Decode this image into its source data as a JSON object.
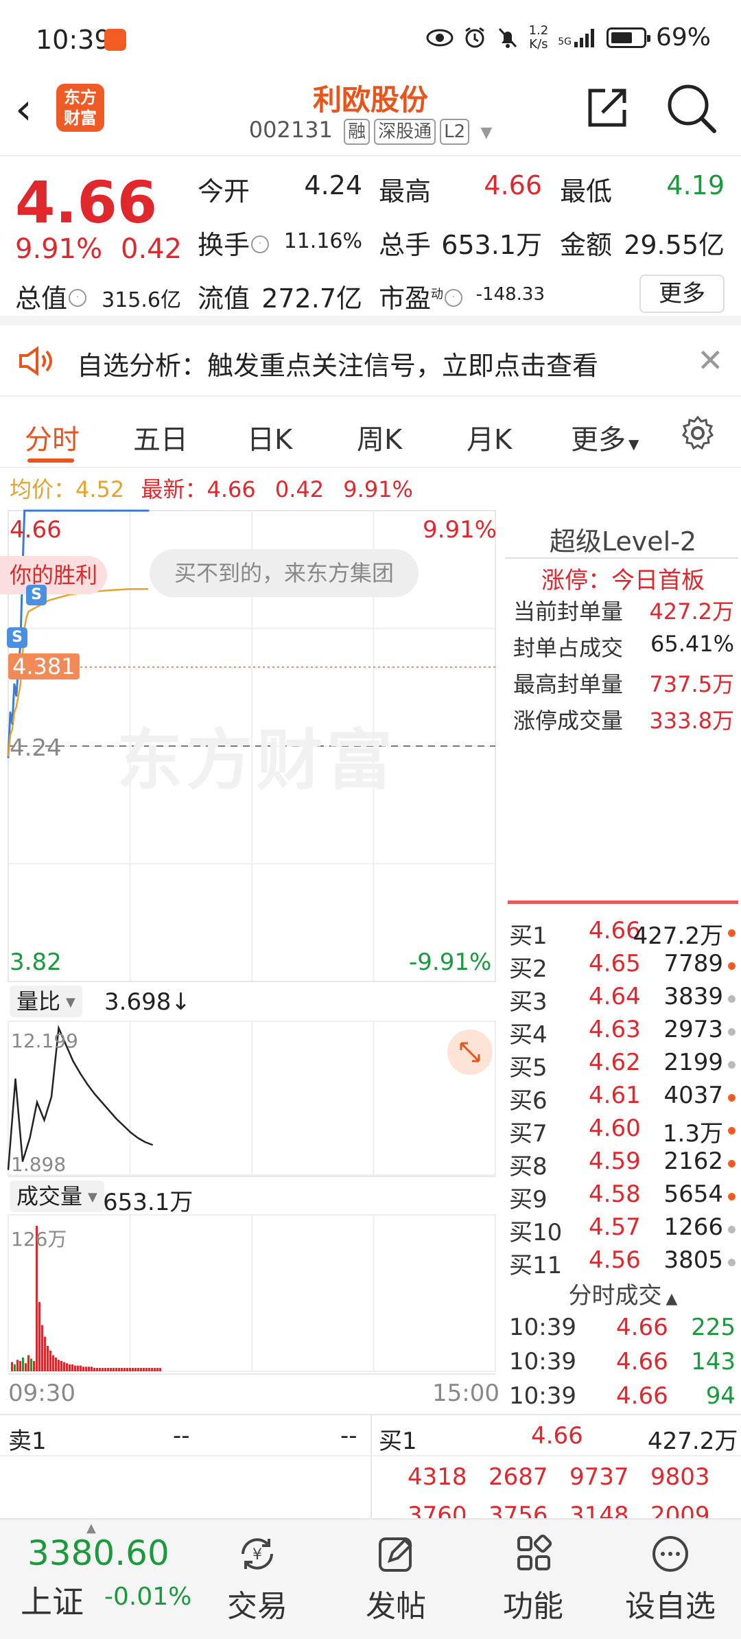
{
  "status_bar": {
    "time": "10:39",
    "net_speed_top": "1.2",
    "net_speed_unit": "K/s",
    "signal": "5G",
    "battery": "69%",
    "battery_level": 0.69
  },
  "header": {
    "logo_text": "东方财富",
    "stock_name": "利欧股份",
    "code": "002131",
    "tags": [
      "融",
      "深股通",
      "L2"
    ]
  },
  "quote": {
    "price": "4.66",
    "pct": "9.91%",
    "chg": "0.42",
    "open_label": "今开",
    "open": "4.24",
    "high_label": "最高",
    "high": "4.66",
    "low_label": "最低",
    "low": "4.19",
    "turnover_label": "换手",
    "turnover": "11.16%",
    "volume_label": "总手",
    "volume": "653.1万",
    "amount_label": "金额",
    "amount": "29.55亿",
    "mktcap_label": "总值",
    "mktcap": "315.6亿",
    "float_label": "流值",
    "float": "272.7亿",
    "pe_label": "市盈",
    "pe_sup": "动",
    "pe": "-148.33",
    "more": "更多"
  },
  "alert": {
    "text": "自选分析：触发重点关注信号，立即点击查看"
  },
  "tabs": [
    "分时",
    "五日",
    "日K",
    "周K",
    "月K",
    "更多"
  ],
  "avg_bar": {
    "avg_label": "均价：",
    "avg": "4.52",
    "last_label": "最新：",
    "last": "4.66",
    "chg": "0.42",
    "pct": "9.91%"
  },
  "main_chart": {
    "price_top": "4.66",
    "pct_top": "9.91%",
    "price_bottom": "3.82",
    "pct_bottom": "-9.91%",
    "open_line": "4.24",
    "marker_price": "4.381",
    "badge_victory": "你的胜利",
    "badge_ad": "买不到的，来东方集团",
    "watermark": "东方财富",
    "s_mark": "S",
    "time_start": "09:30",
    "time_end": "15:00"
  },
  "chart_data": {
    "type": "line",
    "x": [
      "09:30",
      "09:31",
      "09:32",
      "09:33",
      "09:34",
      "09:35",
      "09:36",
      "09:37",
      "09:38",
      "09:39",
      "09:40",
      "09:45",
      "09:50",
      "09:55",
      "10:00",
      "10:10",
      "10:20",
      "10:30",
      "10:39"
    ],
    "series": [
      {
        "values": [
          4.22,
          4.3,
          4.28,
          4.35,
          4.33,
          4.38,
          4.42,
          4.55,
          4.66,
          4.66,
          4.66,
          4.66,
          4.66,
          4.66,
          4.66,
          4.66,
          4.66,
          4.66,
          4.66
        ]
      },
      {
        "values": [
          4.22,
          4.26,
          4.27,
          4.3,
          4.31,
          4.33,
          4.35,
          4.4,
          4.45,
          4.47,
          4.48,
          4.49,
          4.5,
          4.505,
          4.51,
          4.515,
          4.518,
          4.52,
          4.52
        ]
      }
    ],
    "ylim": [
      3.82,
      4.66
    ],
    "reference": 4.24,
    "volume_ratio": {
      "label": "量比",
      "value": "3.698↓",
      "max": "12.199",
      "min": "1.898",
      "values": [
        1.9,
        8.5,
        2.5,
        4.2,
        6.8,
        5.5,
        7.2,
        12.2,
        11.0,
        9.8,
        8.9,
        8.1,
        7.4,
        6.8,
        6.2,
        5.6,
        5.1,
        4.6,
        4.2,
        3.9,
        3.7
      ]
    },
    "volume": {
      "label": "成交量",
      "value": "653.1万",
      "max": "126万",
      "values": [
        8,
        6,
        10,
        9,
        12,
        7,
        14,
        11,
        9,
        126,
        60,
        40,
        30,
        22,
        18,
        14,
        12,
        10,
        9,
        8,
        7,
        6,
        6,
        5,
        5,
        5,
        4,
        4,
        4,
        4,
        3,
        3,
        3,
        3,
        3,
        3,
        3,
        3,
        3,
        3,
        3,
        3,
        3,
        3,
        3,
        3,
        3,
        3,
        3,
        3,
        3,
        3,
        3,
        3,
        3
      ]
    }
  },
  "level2": {
    "title": "超级Level-2",
    "limit_status": "涨停：今日首板",
    "rows": [
      {
        "label": "当前封单量",
        "value": "427.2万",
        "color": "#e0272c"
      },
      {
        "label": "封单占成交",
        "value": "65.41%",
        "color": "#222222"
      },
      {
        "label": "最高封单量",
        "value": "737.5万",
        "color": "#e0272c"
      },
      {
        "label": "涨停成交量",
        "value": "333.8万",
        "color": "#e0272c"
      }
    ]
  },
  "bids": [
    {
      "n": "买1",
      "p": "4.66",
      "q": "427.2万",
      "dot": "#f25c22"
    },
    {
      "n": "买2",
      "p": "4.65",
      "q": "7789",
      "dot": "#f25c22"
    },
    {
      "n": "买3",
      "p": "4.64",
      "q": "3839",
      "dot": "#bbbbbb"
    },
    {
      "n": "买4",
      "p": "4.63",
      "q": "2973",
      "dot": "#bbbbbb"
    },
    {
      "n": "买5",
      "p": "4.62",
      "q": "2199",
      "dot": "#bbbbbb"
    },
    {
      "n": "买6",
      "p": "4.61",
      "q": "4037",
      "dot": "#f25c22"
    },
    {
      "n": "买7",
      "p": "4.60",
      "q": "1.3万",
      "dot": "#f25c22"
    },
    {
      "n": "买8",
      "p": "4.59",
      "q": "2162",
      "dot": "#f25c22"
    },
    {
      "n": "买9",
      "p": "4.58",
      "q": "5654",
      "dot": "#f25c22"
    },
    {
      "n": "买10",
      "p": "4.57",
      "q": "1266",
      "dot": "#bbbbbb"
    },
    {
      "n": "买11",
      "p": "4.56",
      "q": "3805",
      "dot": "#bbbbbb"
    }
  ],
  "ticks": {
    "title": "分时成交",
    "rows": [
      {
        "t": "10:39",
        "p": "4.66",
        "v": "225"
      },
      {
        "t": "10:39",
        "p": "4.66",
        "v": "143"
      },
      {
        "t": "10:39",
        "p": "4.66",
        "v": "94"
      }
    ]
  },
  "strip": {
    "sell_label": "卖1",
    "sell_p": "--",
    "sell_q": "--",
    "buy_label": "买1",
    "buy_p": "4.66",
    "buy_q": "427.2万",
    "queue1": [
      "4318",
      "2687",
      "9737",
      "9803"
    ],
    "queue2": [
      "3760",
      "3756",
      "3148",
      "2009"
    ]
  },
  "bottom_nav": {
    "index_value": "3380.60",
    "index_name": "上证",
    "index_change": "-0.01%",
    "items": [
      "交易",
      "发帖",
      "功能",
      "设自选"
    ]
  }
}
